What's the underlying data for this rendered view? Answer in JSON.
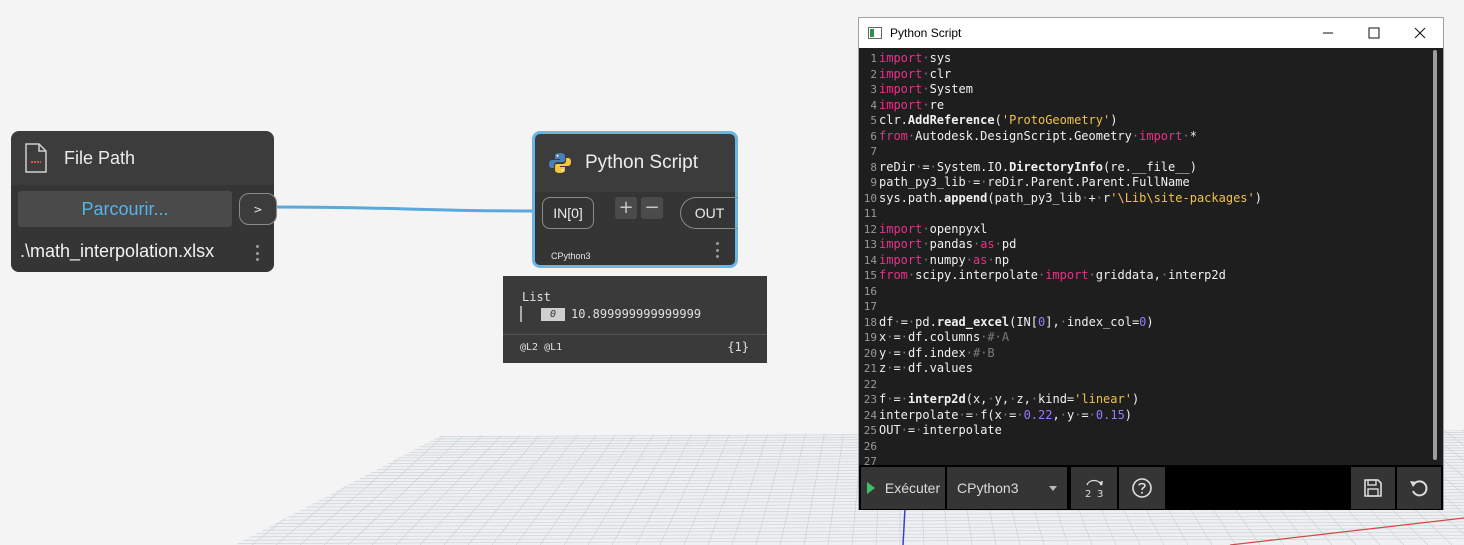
{
  "file_path_node": {
    "title": "File Path",
    "browse_label": "Parcourir...",
    "out_port_label": ">",
    "value": ".\\math_interpolation.xlsx"
  },
  "python_node": {
    "title": "Python Script",
    "in_port_label": "IN[0]",
    "add_label": "+",
    "remove_label": "−",
    "out_port_label": "OUT",
    "engine": "CPython3"
  },
  "preview": {
    "title": "List",
    "index": "0",
    "value": "10.899999999999999",
    "levels": "@L2 @L1",
    "count": "{1}"
  },
  "editor": {
    "window_title": "Python Script",
    "run_label": "Exécuter",
    "engine_select": "CPython3",
    "line_count": 27
  },
  "colors": {
    "wire": "#5aa9db",
    "node_bg": "#3c3c3c",
    "selected_border": "#6ab6e2",
    "keyword": "#e8318a",
    "string": "#f2c14e",
    "number": "#9a79ff"
  }
}
